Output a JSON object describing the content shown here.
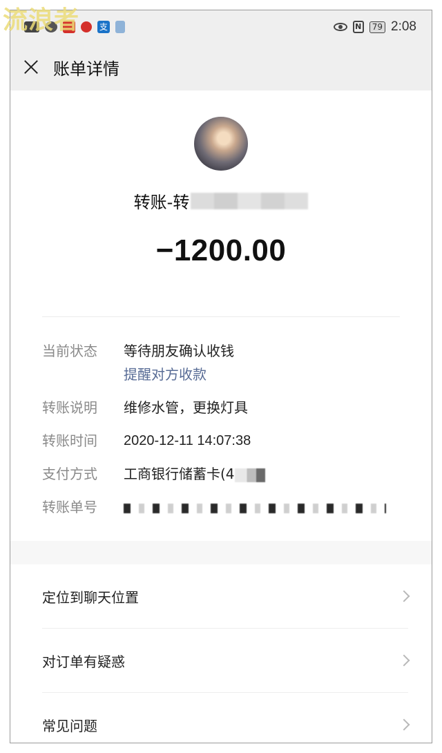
{
  "watermark": "流浪者",
  "status_bar": {
    "time": "2:08",
    "battery": "79",
    "icons": [
      "signal-icon",
      "message-icon",
      "weibo-icon",
      "app-red-icon",
      "alipay-icon",
      "app-blue-icon",
      "eye-icon",
      "nfc-icon",
      "battery-icon"
    ]
  },
  "nav": {
    "close_icon": "close-icon",
    "title": "账单详情"
  },
  "summary": {
    "payee_prefix": "转账-转",
    "amount": "−1200.00"
  },
  "details": {
    "status_label": "当前状态",
    "status_value": "等待朋友确认收钱",
    "remind_link": "提醒对方收款",
    "note_label": "转账说明",
    "note_value": "维修水管，更换灯具",
    "time_label": "转账时间",
    "time_value": "2020-12-11 14:07:38",
    "payment_label": "支付方式",
    "payment_value": "工商银行储蓄卡(4",
    "order_label": "转账单号"
  },
  "menu": [
    {
      "label": "定位到聊天位置"
    },
    {
      "label": "对订单有疑惑"
    },
    {
      "label": "常见问题"
    }
  ]
}
